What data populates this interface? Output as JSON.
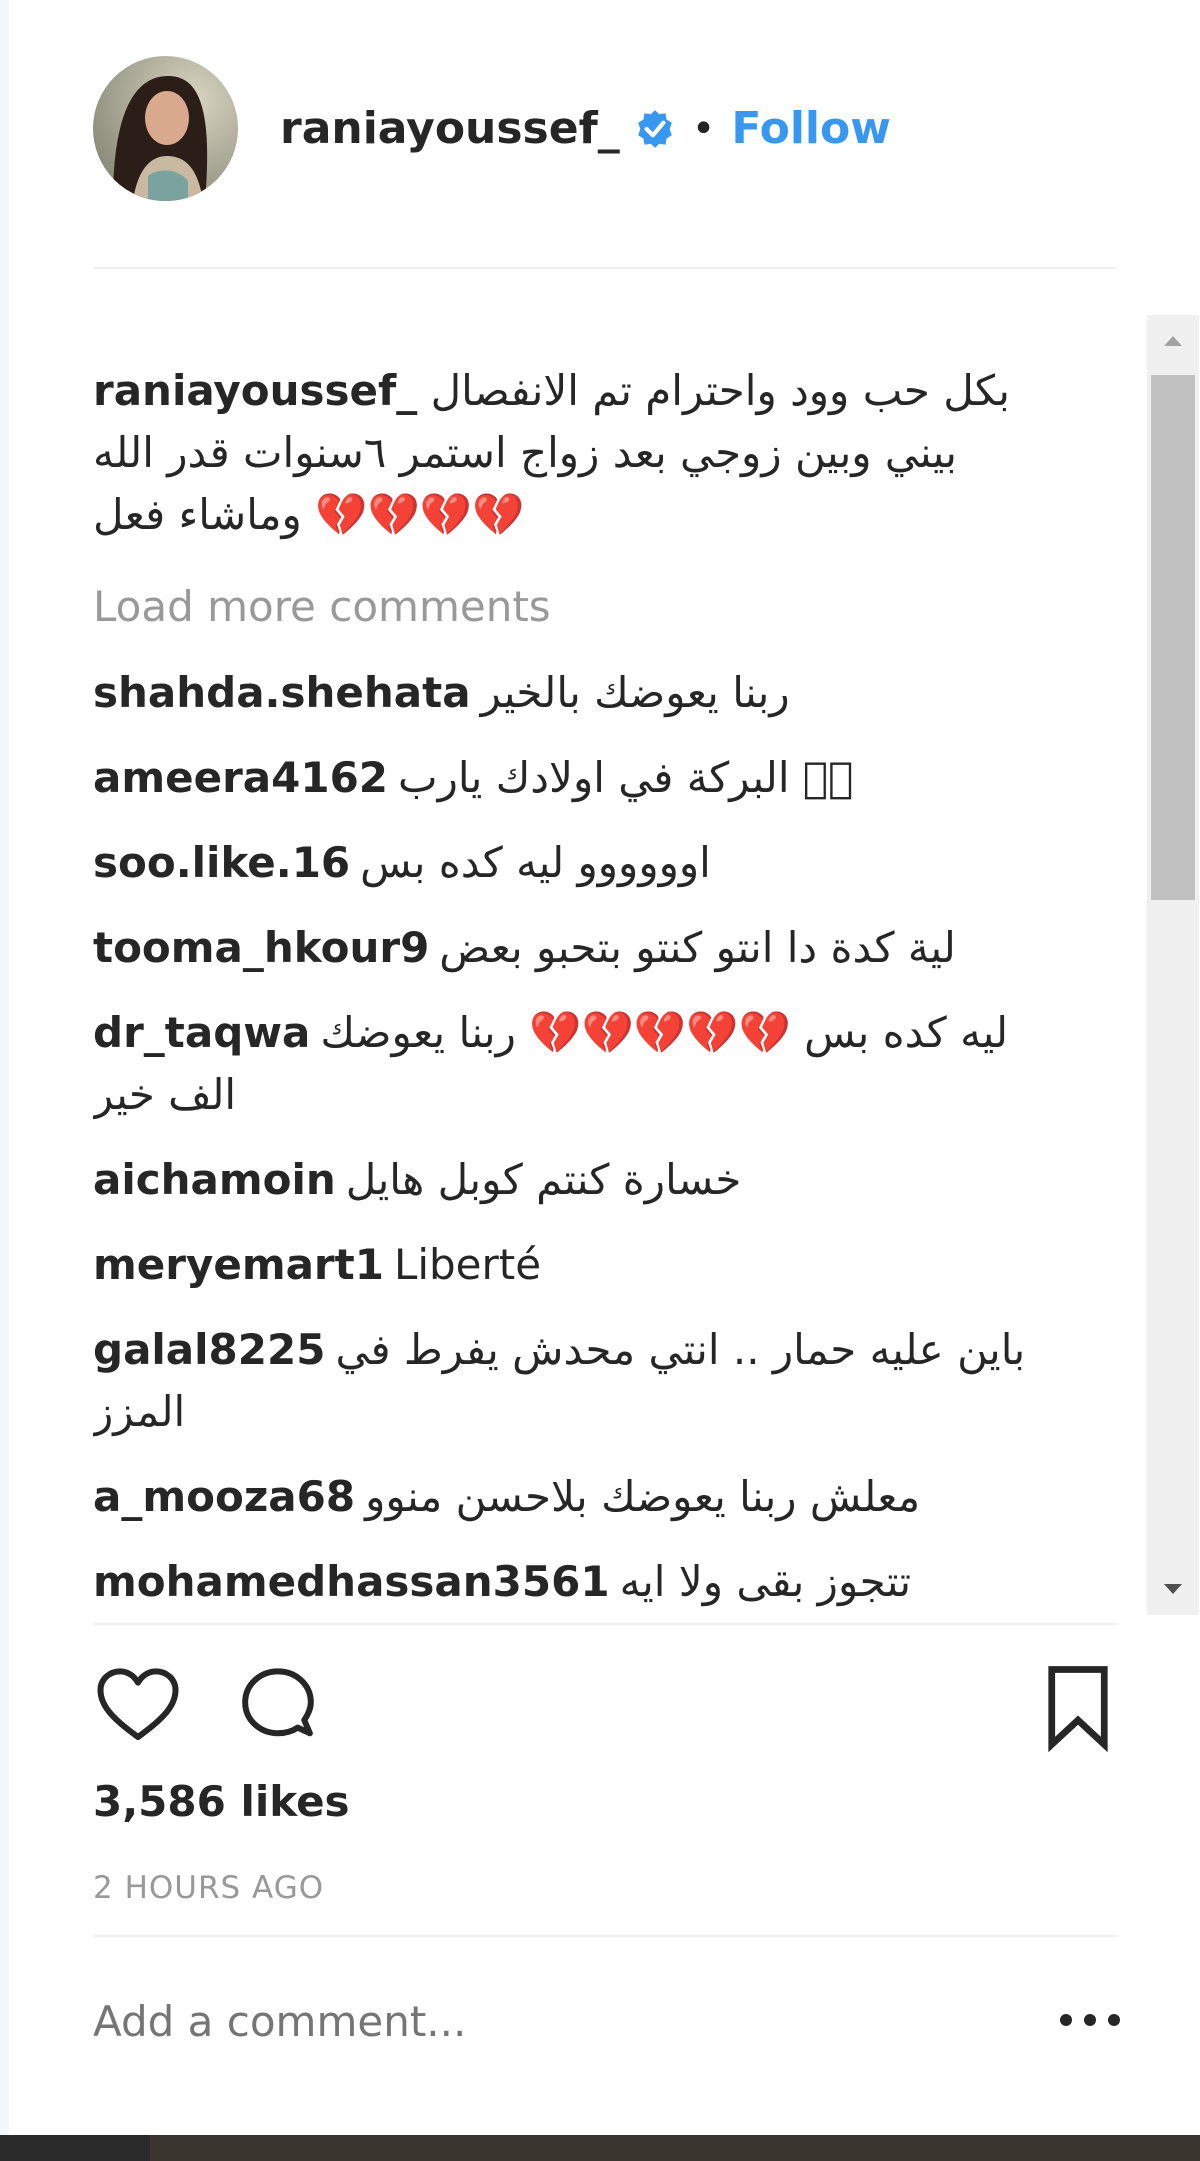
{
  "post": {
    "username": "raniayoussef_",
    "separator": "•",
    "follow_label": "Follow",
    "caption": {
      "username": "raniayoussef_",
      "text": "بكل حب وود واحترام تم الانفصال بيني وبين زوجي بعد زواج استمر ٦سنوات قدر الله وماشاء فعل 💔💔💔💔"
    },
    "load_more_label": "Load more comments",
    "comments": [
      {
        "user": "shahda.shehata",
        "text": "ربنا يعوضك بالخير"
      },
      {
        "user": "ameera4162",
        "text": "البركة في اولادك يارب 􏰀􏰀"
      },
      {
        "user": "soo.like.16",
        "text": "اوووووو ليه كده بس"
      },
      {
        "user": "tooma_hkour9",
        "text": "لية كدة دا انتو كنتو بتحبو بعض"
      },
      {
        "user": "dr_taqwa",
        "text": "ليه كده بس 💔💔💔💔💔 ربنا يعوضك الف خير"
      },
      {
        "user": "aichamoin",
        "text": "خسارة كنتم كوبل هايل"
      },
      {
        "user": "meryemart1",
        "text": "Liberté"
      },
      {
        "user": "galal8225",
        "text": "باين عليه حمار .. انتي محدش يفرط في المزز"
      },
      {
        "user": "a_mooza68",
        "text": "معلش ربنا يعوضك بلاحسن منوو"
      },
      {
        "user": "mohamedhassan3561",
        "text": "تتجوز بقى ولا ايه"
      }
    ],
    "likes": "3,586 likes",
    "time_ago": "2 HOURS AGO",
    "add_comment_placeholder": "Add a comment..."
  },
  "icons": {
    "verified": "verified-badge-icon",
    "like": "heart-icon",
    "comment": "comment-bubble-icon",
    "save": "bookmark-icon",
    "more": "ellipsis-icon"
  },
  "colors": {
    "accent": "#3897f0",
    "text": "#262626",
    "muted": "#999999",
    "divider": "#efefef"
  }
}
